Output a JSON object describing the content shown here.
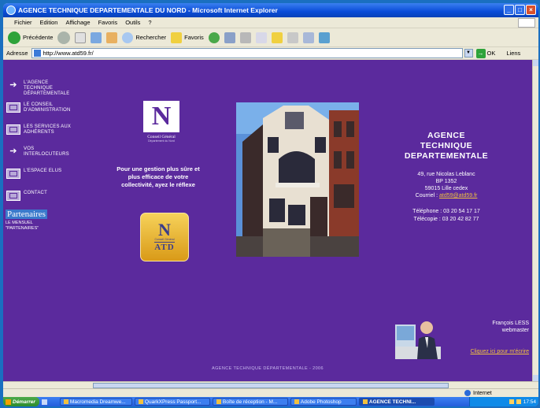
{
  "window": {
    "title": "AGENCE TECHNIQUE DEPARTEMENTALE DU NORD - Microsoft Internet Explorer"
  },
  "menu": [
    "Fichier",
    "Edition",
    "Affichage",
    "Favoris",
    "Outils",
    "?"
  ],
  "toolbar": {
    "back_label": "Précédente",
    "search_label": "Rechercher",
    "favorites_label": "Favoris"
  },
  "address": {
    "label": "Adresse",
    "url": "http://www.atd59.fr/",
    "go_label": "OK",
    "links_label": "Liens"
  },
  "nav": [
    {
      "label": "L'AGENCE\nTECHNIQUE\nDÉPARTEMENTALE",
      "icon": "arrow-right-icon"
    },
    {
      "label": "LE CONSEIL\nD'ADMINISTRATION",
      "icon": "building-icon"
    },
    {
      "label": "LES SERVICES AUX\nADHÉRENTS",
      "icon": "services-icon"
    },
    {
      "label": "VOS\nINTERLOCUTEURS",
      "icon": "arrow-right-icon"
    },
    {
      "label": "L'ESPACE ELUS",
      "icon": "building-icon"
    },
    {
      "label": "CONTACT",
      "icon": "contact-icon"
    }
  ],
  "partners": {
    "logo_text": "Partenaires",
    "subtitle": "LE MENSUEL\n\"PARTENAIRES\""
  },
  "conseil_logo": {
    "monogram": "N",
    "name": "Conseil Général",
    "sub": "Département du Nord"
  },
  "slogan": "Pour une gestion plus sûre et plus efficace de votre collectivité, ayez le réflexe",
  "atd_logo": {
    "monogram": "N",
    "cg": "Conseil Général",
    "label": "ATD"
  },
  "agency": {
    "name_line1": "AGENCE",
    "name_line2": "TECHNIQUE",
    "name_line3": "DEPARTEMENTALE",
    "street": "49, rue Nicolas Leblanc",
    "bp": "BP 1352",
    "city": "59015 Lille cedex",
    "mail_label": "Courriel : ",
    "mail": "atd59@atd59.fr",
    "phone": "Téléphone : 03 20 54 17 17",
    "fax": "Télécopie : 03 20 42 82 77"
  },
  "webmaster": {
    "name": "François LESS",
    "role": "webmaster",
    "link": "Cliquez ici pour m'écrire"
  },
  "footer": "AGENCE TECHNIQUE DÉPARTEMENTALE - 2006",
  "statusbar": {
    "zone": "Internet"
  },
  "taskbar": {
    "start": "Démarrer",
    "tasks": [
      "Macromedia Dreamwe...",
      "QuarkXPress Passport...",
      "Boîte de réception - M...",
      "Adobe Photoshop",
      "AGENCE TECHNI..."
    ],
    "clock": "17:54"
  },
  "colors": {
    "page_bg": "#5b2a9d",
    "link": "#f0c040",
    "titlebar": "#0a4cd8"
  }
}
